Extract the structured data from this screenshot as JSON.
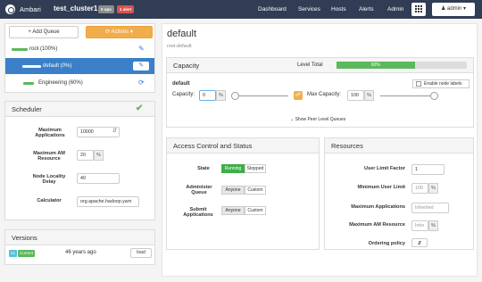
{
  "topbar": {
    "brand": "Ambari",
    "cluster": "test_cluster1",
    "ops_badge": "0 ops",
    "alerts_badge": "1 alert",
    "nav": [
      "Dashboard",
      "Services",
      "Hosts",
      "Alerts",
      "Admin"
    ],
    "user": "admin ▾"
  },
  "left": {
    "add_queue": "+ Add Queue",
    "actions": "⟳ Actions ▾",
    "queues": [
      {
        "label": "root (100%)",
        "bar_color": "#5cb85c"
      },
      {
        "label": "default (0%)",
        "bar_color": "#ffffff"
      },
      {
        "label": "Engineering (60%)",
        "bar_color": "#5cb85c"
      }
    ],
    "scheduler": {
      "title": "Scheduler",
      "max_apps_label": "Maximum Applications",
      "max_apps_value": "10000",
      "max_am_label": "Maximum AM Resource",
      "max_am_value": "20",
      "max_am_unit": "%",
      "delay_label": "Node Locality Delay",
      "delay_value": "40",
      "calc_label": "Calculator",
      "calc_value": "org.apache.hadoop.yarn"
    },
    "versions": {
      "title": "Versions",
      "v_tag": "v1",
      "current_tag": "Current",
      "age": "46 years ago",
      "load": "load"
    }
  },
  "main": {
    "title": "default",
    "path": "root.default",
    "capacity": {
      "title": "Capacity",
      "level_total_label": "Level Total",
      "level_total_value": "60%",
      "level_total_fraction": 0.6,
      "queue_name": "default",
      "enable_labels": "Enable node labels",
      "capacity_label": "Capacity:",
      "capacity_value": "0",
      "pct": "%",
      "max_capacity_label": "Max Capacity:",
      "max_capacity_value": "100",
      "peer_link": "⌄ Show Peer Level Queues"
    },
    "acl": {
      "title": "Access Control and Status",
      "state_label": "State",
      "running": "Running",
      "stopped": "Stopped",
      "admin_label": "Administer Queue",
      "submit_label": "Submit Applications",
      "anyone": "Anyone",
      "custom": "Custom"
    },
    "resources": {
      "title": "Resources",
      "ulf_label": "User Limit Factor",
      "ulf_value": "1",
      "mul_label": "Minimum User Limit",
      "mul_value": "100",
      "max_apps_label": "Maximum Applications",
      "max_apps_placeholder": "Inherited",
      "max_am_label": "Maximum AM Resource",
      "max_am_placeholder": "Inhe",
      "order_label": "Ordering policy",
      "pct": "%"
    }
  },
  "colors": {
    "topbar": "#303d54",
    "selected": "#3a7fc8",
    "green": "#5cb85c",
    "orange": "#f0ad4e",
    "red": "#d9534f"
  }
}
